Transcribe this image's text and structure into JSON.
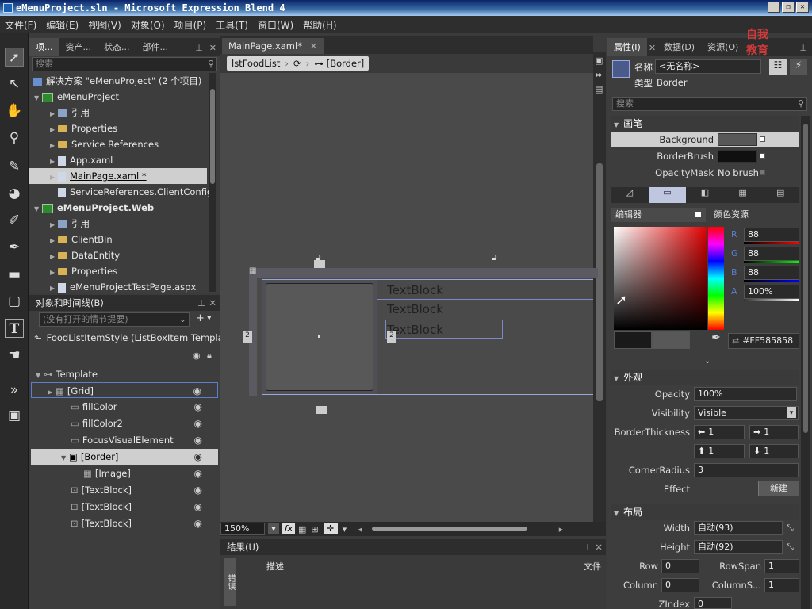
{
  "window": {
    "title": "eMenuProject.sln - Microsoft Expression Blend 4",
    "buttons": [
      "_",
      "❐",
      "✕"
    ]
  },
  "menu": [
    "文件(F)",
    "编辑(E)",
    "视图(V)",
    "对象(O)",
    "项目(P)",
    "工具(T)",
    "窗口(W)",
    "帮助(H)"
  ],
  "toolbox": [
    "selection-tool",
    "direct-selection-tool",
    "pan-tool",
    "zoom-tool",
    "eyedropper-tool",
    "paint-bucket-tool",
    "brush-tool",
    "pen-tool",
    "rectangle-tool",
    "layout-panel-tool",
    "textblock-tool",
    "control-tool",
    "assets-tool",
    "media-tool"
  ],
  "project_panel": {
    "tabs": [
      "项...",
      "资产...",
      "状态...",
      "部件..."
    ],
    "search_placeholder": "搜索",
    "solution": "解决方案 \"eMenuProject\" (2 个项目)",
    "items": [
      {
        "label": "eMenuProject",
        "type": "project",
        "bold": true
      },
      {
        "label": "引用",
        "type": "ref"
      },
      {
        "label": "Properties",
        "type": "folder"
      },
      {
        "label": "Service References",
        "type": "folder"
      },
      {
        "label": "App.xaml",
        "type": "file"
      },
      {
        "label": "MainPage.xaml *",
        "type": "file",
        "selected": true
      },
      {
        "label": "ServiceReferences.ClientConfig",
        "type": "file"
      },
      {
        "label": "eMenuProject.Web",
        "type": "project",
        "bold": true
      },
      {
        "label": "引用",
        "type": "ref"
      },
      {
        "label": "ClientBin",
        "type": "folder"
      },
      {
        "label": "DataEntity",
        "type": "folder"
      },
      {
        "label": "Properties",
        "type": "folder"
      },
      {
        "label": "eMenuProjectTestPage.aspx",
        "type": "file"
      }
    ]
  },
  "objects_panel": {
    "title": "对象和时间线(B)",
    "search_placeholder": "(没有打开的情节提要)",
    "scope": "FoodListItemStyle (ListBoxItem Templat...",
    "items": [
      "Template",
      "[Grid]",
      "fillColor",
      "fillColor2",
      "FocusVisualElement",
      "[Border]",
      "[Image]",
      "[TextBlock]",
      "[TextBlock]",
      "[TextBlock]"
    ]
  },
  "document": {
    "tab": "MainPage.xaml*",
    "breadcrumb": [
      "lstFoodList",
      "",
      "[Border]"
    ],
    "textblocks": [
      "TextBlock",
      "TextBlock",
      "TextBlock"
    ],
    "margin_labels": [
      "2",
      "2"
    ],
    "zoom": "150%",
    "zoom_value": 150
  },
  "results_panel": {
    "title": "结果(U)",
    "side_tab": "错误",
    "columns": [
      "描述",
      "文件"
    ]
  },
  "properties_panel": {
    "tabs": [
      "属性(I)",
      "数据(D)",
      "资源(O)"
    ],
    "name_label": "名称",
    "name_value": "<无名称>",
    "type_label": "类型",
    "type_value": "Border",
    "search_placeholder": "搜索",
    "brush_section": "画笔",
    "brushes": [
      {
        "label": "Background",
        "value": "",
        "swatch": "#585858",
        "selected": true
      },
      {
        "label": "BorderBrush",
        "value": "",
        "swatch": "#101010"
      },
      {
        "label": "OpacityMask",
        "value": "No brush",
        "swatch": ""
      }
    ],
    "editor_tab": "编辑器",
    "color_resources_tab": "颜色资源",
    "rgba": [
      {
        "label": "R",
        "value": "88"
      },
      {
        "label": "G",
        "value": "88"
      },
      {
        "label": "B",
        "value": "88"
      },
      {
        "label": "A",
        "value": "100%"
      }
    ],
    "hex": "#FF585858",
    "appearance_section": "外观",
    "opacity_label": "Opacity",
    "opacity_value": "100%",
    "visibility_label": "Visibility",
    "visibility_value": "Visible",
    "border_thickness_label": "BorderThickness",
    "border_thickness": [
      "1",
      "1",
      "1",
      "1"
    ],
    "corner_radius_label": "CornerRadius",
    "corner_radius": "3",
    "effect_label": "Effect",
    "new_button": "新建",
    "layout_section": "布局",
    "width_label": "Width",
    "width_value": "自动(93)",
    "height_label": "Height",
    "height_value": "自动(92)",
    "row_label": "Row",
    "row_value": "0",
    "rowspan_label": "RowSpan",
    "rowspan_value": "1",
    "column_label": "Column",
    "column_value": "0",
    "columnspan_label": "ColumnS...",
    "columnspan_value": "1",
    "zindex_label": "ZIndex",
    "zindex_value": "0"
  },
  "watermark": "自我教育",
  "colors": {
    "accent": "#5a7fcf",
    "selection_row": "#cfcfcf",
    "swatch": "#585858"
  }
}
